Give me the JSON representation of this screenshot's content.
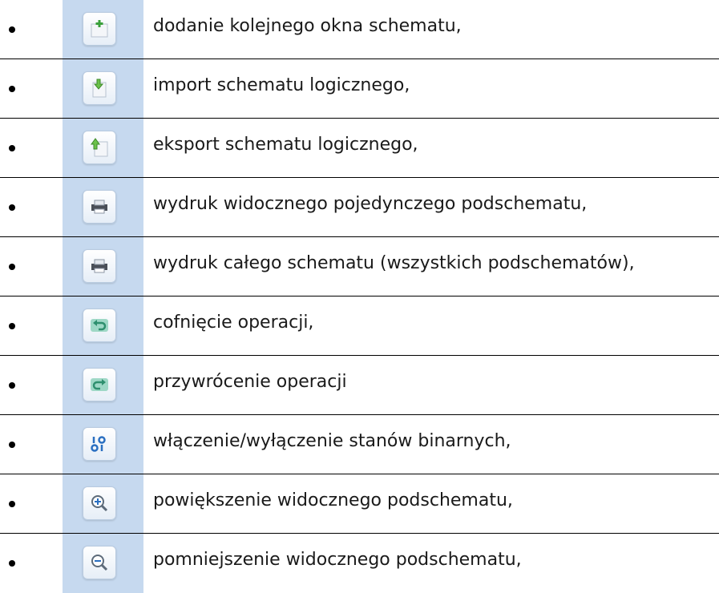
{
  "items": [
    {
      "icon": "add-window-icon",
      "label": "dodanie kolejnego okna schematu,"
    },
    {
      "icon": "import-icon",
      "label": "import schematu logicznego,"
    },
    {
      "icon": "export-icon",
      "label": "eksport schematu logicznego,"
    },
    {
      "icon": "print-icon",
      "label": "wydruk widocznego pojedynczego podschematu,"
    },
    {
      "icon": "print-all-icon",
      "label": "wydruk całego schematu (wszystkich podschematów),"
    },
    {
      "icon": "undo-icon",
      "label": "cofnięcie operacji,"
    },
    {
      "icon": "redo-icon",
      "label": "przywrócenie operacji"
    },
    {
      "icon": "binary-states-icon",
      "label": "włączenie/wyłączenie stanów binarnych,"
    },
    {
      "icon": "zoom-in-icon",
      "label": "powiększenie widocznego  podschematu,"
    },
    {
      "icon": "zoom-out-icon",
      "label": "pomniejszenie widocznego podschematu,"
    }
  ]
}
